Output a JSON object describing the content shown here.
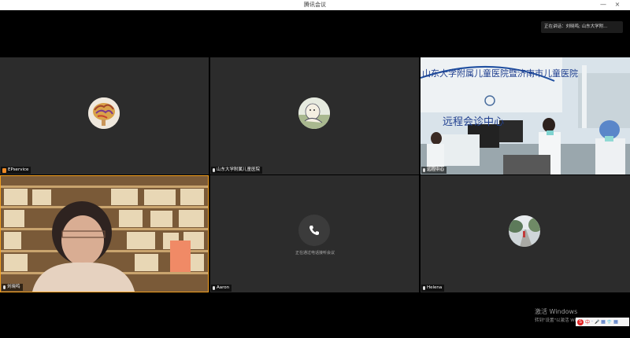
{
  "window": {
    "title": "腾讯会议",
    "minimize": "—",
    "close": "×"
  },
  "toast": {
    "text": "正在讲话：刘晓鸣; 山东大学附..."
  },
  "participants": [
    {
      "name": "EPservice",
      "avatar": "brain-avatar"
    },
    {
      "name": "山东大学附属儿童医院",
      "avatar": "cartoon-avatar"
    },
    {
      "name": "远程中心",
      "video": "remote-consultation-room"
    },
    {
      "name": "刘晓鸣",
      "video": "speaker-with-bookshelf"
    },
    {
      "name": "Aaron",
      "status": "正在通过电话接听会议"
    },
    {
      "name": "Helena",
      "avatar": "road-photo-avatar"
    }
  ],
  "room_sign": {
    "banner": "山东大学附属儿童医院暨济南市儿童医院",
    "consult": "远程会诊中心"
  },
  "activation": {
    "line1": "激活 Windows",
    "line2": "转到\"设置\"以激活 Windows。"
  },
  "ime": {
    "items": [
      "中",
      "·",
      "🎤",
      "▦",
      "👕",
      "▦"
    ]
  },
  "colors": {
    "tile_bg": "#2c2c2c",
    "background": "#000000",
    "ime_red": "#e02020"
  }
}
